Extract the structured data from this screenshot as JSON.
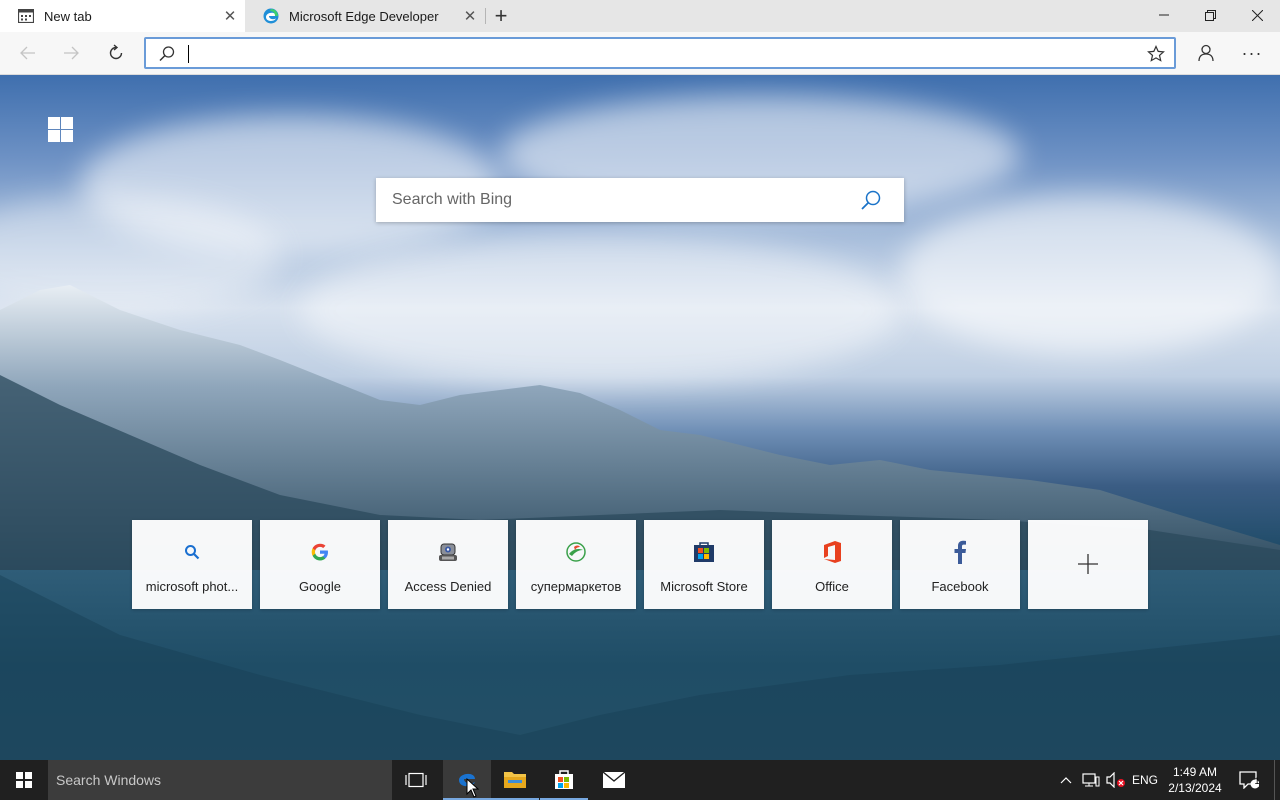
{
  "browser": {
    "tabs": [
      {
        "label": "New tab",
        "active": true,
        "icon": "new-tab-page-icon"
      },
      {
        "label": "Microsoft Edge Developer",
        "active": false,
        "icon": "edge-logo-icon"
      }
    ],
    "new_tab_symbol": "+",
    "address_bar": {
      "value": "",
      "placeholder": ""
    },
    "more_symbol": "···"
  },
  "new_tab_page": {
    "search": {
      "placeholder": "Search with Bing"
    },
    "quick_links": [
      {
        "label": "microsoft phot...",
        "icon": "search-icon"
      },
      {
        "label": "Google",
        "icon": "google-logo-icon"
      },
      {
        "label": "Access Denied",
        "icon": "robot-icon"
      },
      {
        "label": "супермаркетов",
        "icon": "leaf-logo-icon"
      },
      {
        "label": "Microsoft Store",
        "icon": "store-icon"
      },
      {
        "label": "Office",
        "icon": "office-icon"
      },
      {
        "label": "Facebook",
        "icon": "facebook-icon"
      },
      {
        "label": "",
        "icon": "plus-icon"
      }
    ],
    "add_symbol": "+"
  },
  "taskbar": {
    "search_text": "Search Windows",
    "language": "ENG",
    "time": "1:49 AM",
    "date": "2/13/2024",
    "notification_count": "1"
  },
  "colors": {
    "accent": "#0078d7",
    "taskbar": "#202020",
    "address_border": "#6a9bd8"
  }
}
